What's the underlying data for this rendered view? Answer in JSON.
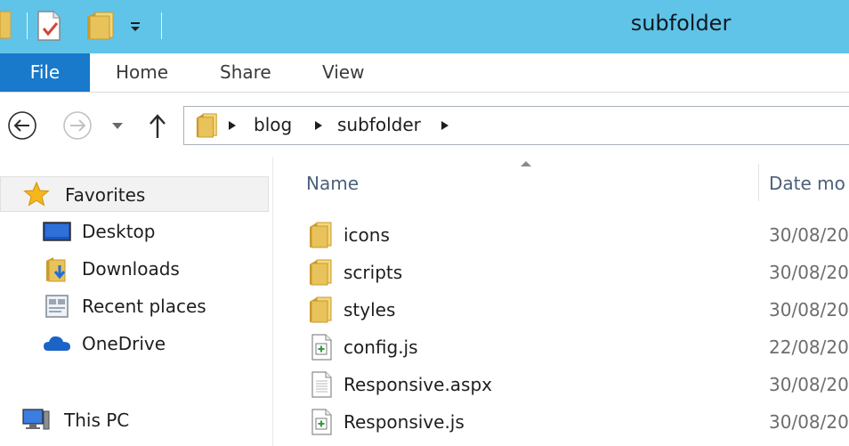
{
  "window": {
    "title": "subfolder"
  },
  "ribbon": {
    "tabs": [
      "File",
      "Home",
      "Share",
      "View"
    ],
    "active_tab": "File"
  },
  "address": {
    "crumbs": [
      "blog",
      "subfolder"
    ]
  },
  "nav_pane": {
    "favorites": "Favorites",
    "items": [
      "Desktop",
      "Downloads",
      "Recent places",
      "OneDrive"
    ],
    "this_pc": "This PC"
  },
  "file_list": {
    "columns": [
      "Name",
      "Date mo"
    ],
    "rows": [
      {
        "name": "icons",
        "date": "30/08/20",
        "icon": "folder-icon"
      },
      {
        "name": "scripts",
        "date": "30/08/20",
        "icon": "folder-icon"
      },
      {
        "name": "styles",
        "date": "30/08/20",
        "icon": "folder-icon"
      },
      {
        "name": "config.js",
        "date": "22/08/20",
        "icon": "js-file-icon"
      },
      {
        "name": "Responsive.aspx",
        "date": "30/08/20",
        "icon": "aspx-file-icon"
      },
      {
        "name": "Responsive.js",
        "date": "30/08/20",
        "icon": "js-file-icon"
      }
    ]
  },
  "colors": {
    "titlebar": "#5fc4e8",
    "file_tab": "#1979ca",
    "folder": "#e8c25a",
    "selection": "#f2f2f2"
  }
}
